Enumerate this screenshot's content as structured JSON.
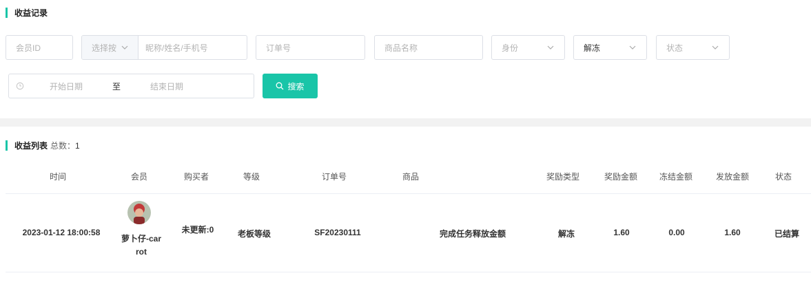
{
  "filter_section": {
    "title": "收益记录"
  },
  "filters": {
    "member_id_placeholder": "会员ID",
    "select_by_label": "选择按",
    "name_phone_placeholder": "昵称/姓名/手机号",
    "order_no_placeholder": "订单号",
    "product_name_placeholder": "商品名称",
    "identity_placeholder": "身份",
    "freeze_selected": "解冻",
    "status_placeholder": "状态",
    "start_date_placeholder": "开始日期",
    "range_separator": "至",
    "end_date_placeholder": "结束日期",
    "search_button": "搜索"
  },
  "list_section": {
    "title": "收益列表",
    "count_label": "总数：",
    "count_value": "1"
  },
  "table": {
    "headers": {
      "time": "时间",
      "member": "会员",
      "buyer": "购买者",
      "level": "等级",
      "order_no": "订单号",
      "product": "商品",
      "reward_type": "奖励类型",
      "reward_amount": "奖励金额",
      "frozen_amount": "冻结金额",
      "paid_amount": "发放金额",
      "status": "状态"
    },
    "rows": [
      {
        "time": "2023-01-12 18:00:58",
        "member_name_line1": "萝卜仔-car",
        "member_name_line2": "rot",
        "buyer": "未更新:0",
        "level": "老板等级",
        "order_no": "SF20230111",
        "product": "完成任务释放金额",
        "reward_type": "解冻",
        "reward_amount": "1.60",
        "frozen_amount": "0.00",
        "paid_amount": "1.60",
        "status": "已结算"
      }
    ]
  },
  "colors": {
    "accent": "#19c5a8",
    "border": "#dcdfe6"
  }
}
